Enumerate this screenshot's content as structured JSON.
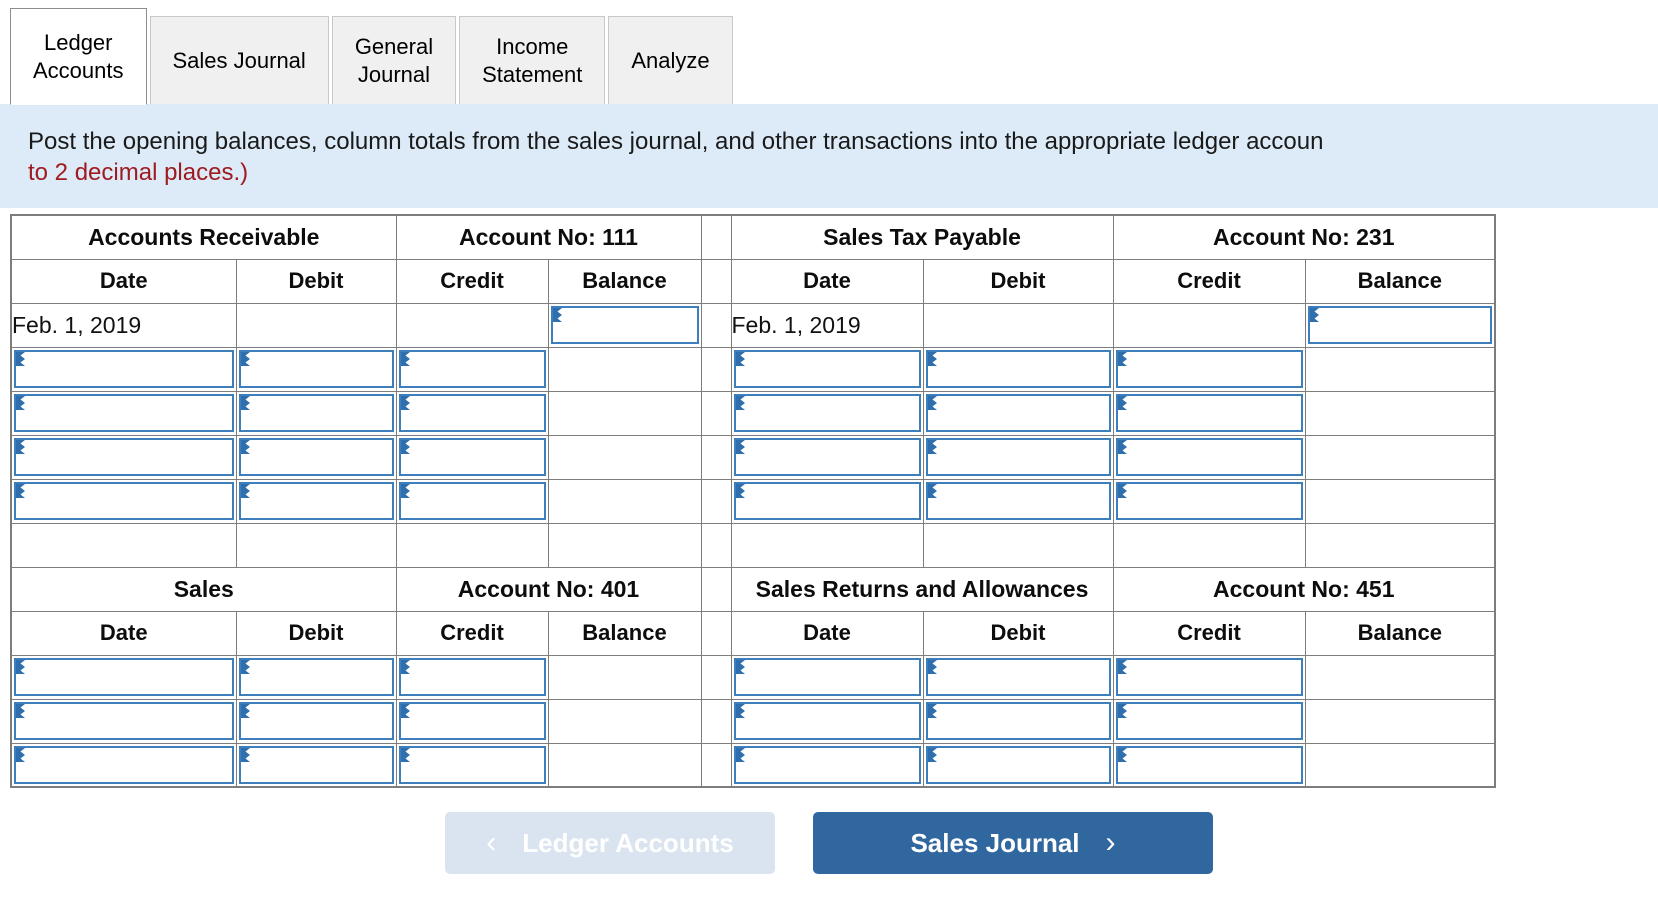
{
  "tabs": [
    {
      "label": "Ledger\nAccounts",
      "active": true
    },
    {
      "label": "Sales Journal",
      "active": false
    },
    {
      "label": "General\nJournal",
      "active": false
    },
    {
      "label": "Income\nStatement",
      "active": false
    },
    {
      "label": "Analyze",
      "active": false
    }
  ],
  "banner": {
    "line1": "Post the opening balances, column totals from the sales journal, and other transactions into the appropriate ledger accoun",
    "line2": "to 2 decimal places.)"
  },
  "ledger": {
    "column_headers": {
      "date": "Date",
      "debit": "Debit",
      "credit": "Credit",
      "balance": "Balance"
    },
    "sections": [
      {
        "left": {
          "account_name": "Accounts Receivable",
          "account_no": "Account No: 111",
          "opening_date": "Feb. 1, 2019",
          "opening_balance": "",
          "rows": [
            {
              "date": "",
              "debit": "",
              "credit": "",
              "balance": ""
            },
            {
              "date": "",
              "debit": "",
              "credit": "",
              "balance": ""
            },
            {
              "date": "",
              "debit": "",
              "credit": "",
              "balance": ""
            },
            {
              "date": "",
              "debit": "",
              "credit": "",
              "balance": ""
            }
          ]
        },
        "right": {
          "account_name": "Sales Tax Payable",
          "account_no": "Account No: 231",
          "opening_date": "Feb. 1, 2019",
          "opening_balance": "",
          "rows": [
            {
              "date": "",
              "debit": "",
              "credit": "",
              "balance": ""
            },
            {
              "date": "",
              "debit": "",
              "credit": "",
              "balance": ""
            },
            {
              "date": "",
              "debit": "",
              "credit": "",
              "balance": ""
            },
            {
              "date": "",
              "debit": "",
              "credit": "",
              "balance": ""
            }
          ]
        }
      },
      {
        "left": {
          "account_name": "Sales",
          "account_no": "Account No: 401",
          "rows": [
            {
              "date": "",
              "debit": "",
              "credit": "",
              "balance": ""
            },
            {
              "date": "",
              "debit": "",
              "credit": "",
              "balance": ""
            },
            {
              "date": "",
              "debit": "",
              "credit": "",
              "balance": ""
            }
          ]
        },
        "right": {
          "account_name": "Sales Returns and Allowances",
          "account_no": "Account No: 451",
          "rows": [
            {
              "date": "",
              "debit": "",
              "credit": "",
              "balance": ""
            },
            {
              "date": "",
              "debit": "",
              "credit": "",
              "balance": ""
            },
            {
              "date": "",
              "debit": "",
              "credit": "",
              "balance": ""
            }
          ]
        }
      }
    ]
  },
  "footer": {
    "prev_label": "Ledger Accounts",
    "prev_chevron": "‹",
    "next_label": "Sales Journal",
    "next_chevron": "›"
  },
  "colors": {
    "header_blue": "#7dacdd",
    "banner_blue": "#dcebf7",
    "input_border": "#3d7fbd",
    "next_button": "#31679f",
    "prev_button": "#d9e4f0",
    "note_red": "#9e1b20",
    "grid_line": "#7d7d7d"
  }
}
